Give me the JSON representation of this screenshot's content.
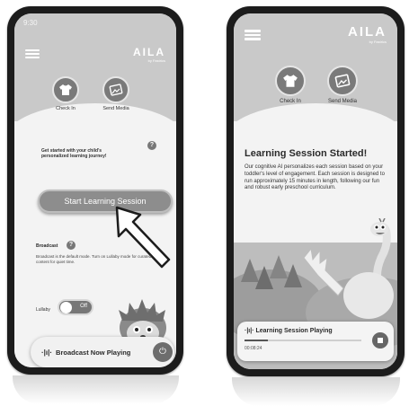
{
  "phone1": {
    "status_time": "9:30",
    "logo": "AILA",
    "logo_sub": "by Fastrics",
    "tiles": [
      {
        "label": "Check In",
        "icon": "shirt-icon"
      },
      {
        "label": "Send Media",
        "icon": "media-icon"
      }
    ],
    "prompt": "Get started with your child's personalized learning journey!",
    "start_button": "Start Learning Session",
    "broadcast_label": "Broadcast",
    "broadcast_desc": "Broadcast is the default mode. Turn on Lullaby mode for curated content for quiet time.",
    "lullaby_label": "Lullaby",
    "toggle_state": "Off",
    "now_playing": "Broadcast Now Playing"
  },
  "phone2": {
    "logo": "AILA",
    "logo_sub": "by Fastrics",
    "tiles": [
      {
        "label": "Check In",
        "icon": "shirt-icon"
      },
      {
        "label": "Send Media",
        "icon": "media-icon"
      }
    ],
    "title": "Learning Session Started!",
    "description": "Our cognitive AI personalizes each session based on your toddler's level of engagement. Each session is designed to run approximately 15 minutes in length, following our fun and robust early preschool curriculum.",
    "player_title": "Learning Session Playing",
    "elapsed": "00:08:24",
    "progress": 0.2
  },
  "colors": {
    "header": "#c9c9c9",
    "button": "#8d8d8d",
    "icon_bg": "#7a7a7a"
  }
}
